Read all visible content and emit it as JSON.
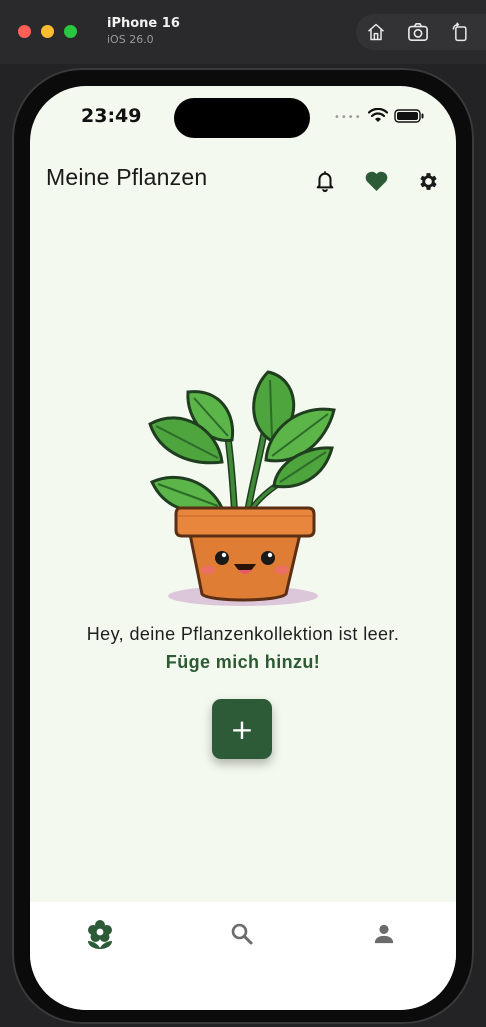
{
  "simulator": {
    "device_name": "iPhone 16",
    "os_version": "iOS 26.0",
    "toolbar_icons": [
      "home-icon",
      "screenshot-icon",
      "rotate-icon"
    ]
  },
  "status_bar": {
    "time": "23:49",
    "icons": [
      "cellular-dots-icon",
      "wifi-icon",
      "battery-icon"
    ]
  },
  "header": {
    "title": "Meine Pflanzen",
    "icons": [
      "bell-icon",
      "heart-icon",
      "gear-icon"
    ]
  },
  "empty_state": {
    "illustration": "potted-plant-illustration",
    "message": "Hey, deine Pflanzenkollektion ist leer.",
    "cta": "Füge mich hinzu!",
    "add_button_label": "+"
  },
  "bottom_nav": {
    "items": [
      {
        "icon": "flower-icon",
        "active": true
      },
      {
        "icon": "search-icon",
        "active": false
      },
      {
        "icon": "person-icon",
        "active": false
      }
    ]
  },
  "colors": {
    "screen_bg": "#f3f9ee",
    "brand_green": "#2e5b37",
    "nav_bg": "#ffffff"
  }
}
